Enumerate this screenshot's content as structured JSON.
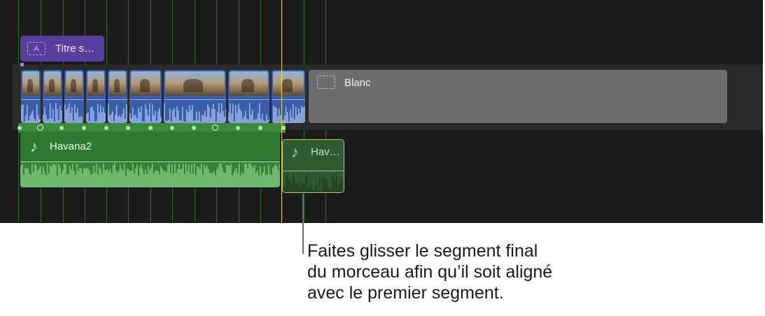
{
  "title_clip": {
    "label": "Titre s…",
    "icon": "title-text-icon",
    "icon_glyph": "A"
  },
  "video_clips": [
    {
      "name": "video-clip-1"
    },
    {
      "name": "video-clip-2"
    },
    {
      "name": "video-clip-3"
    },
    {
      "name": "video-clip-4"
    },
    {
      "name": "video-clip-5"
    },
    {
      "name": "video-clip-6"
    },
    {
      "name": "video-clip-7"
    },
    {
      "name": "video-clip-8"
    },
    {
      "name": "video-clip-9"
    }
  ],
  "gap_clip": {
    "label": "Blanc",
    "icon": "gap-placeholder-icon"
  },
  "audio_clip_main": {
    "label": "Havana2",
    "icon": "music-note-icon",
    "icon_glyph": "♪"
  },
  "audio_clip_end": {
    "label": "Hav…",
    "icon": "music-note-icon",
    "icon_glyph": "♪"
  },
  "callout": {
    "line1": "Faites glisser le segment final",
    "line2": "du morceau afin qu’il soit aligné",
    "line3": "avec le premier segment."
  },
  "colors": {
    "timeline_bg": "#1b1b1b",
    "video_clip": "#3a5da8",
    "title_clip": "#5a3e9e",
    "audio_clip": "#2f7a33",
    "gap_clip": "#6d6d70",
    "playhead": "#e8d84a",
    "selection_outline": "#b6c954"
  }
}
